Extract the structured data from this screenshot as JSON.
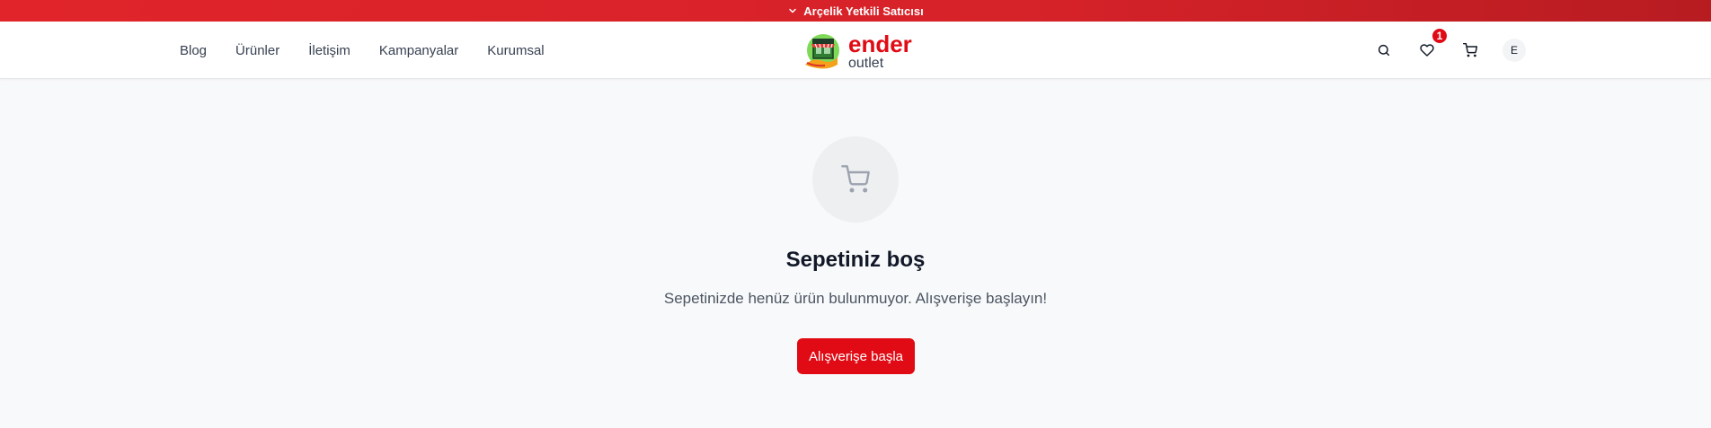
{
  "announcement": {
    "text": "Arçelik Yetkili Satıcısı"
  },
  "nav": {
    "items": [
      {
        "label": "Blog"
      },
      {
        "label": "Ürünler"
      },
      {
        "label": "İletişim"
      },
      {
        "label": "Kampanyalar"
      },
      {
        "label": "Kurumsal"
      }
    ]
  },
  "logo": {
    "brand": "ender",
    "sub": "outlet"
  },
  "header_actions": {
    "search_icon": "search-icon",
    "favorites_icon": "heart-icon",
    "favorites_count": "1",
    "cart_icon": "cart-icon",
    "avatar_initial": "E"
  },
  "cart_empty": {
    "icon": "cart-icon",
    "title": "Sepetiniz boş",
    "message": "Sepetinizde henüz ürün bulunmuyor. Alışverişe başlayın!",
    "cta_label": "Alışverişe başla"
  },
  "colors": {
    "accent": "#e00b14",
    "announcement_bg": "#d62229",
    "page_bg": "#f8f9fa"
  }
}
